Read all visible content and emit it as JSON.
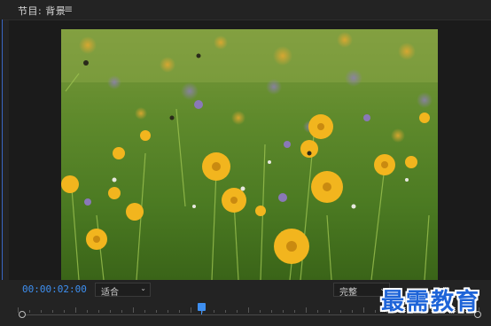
{
  "panel": {
    "title": "节目: 背景",
    "menu_icon": "≡"
  },
  "frame": {
    "subject": "meadow-flowers-photo"
  },
  "controls": {
    "timecode": "00:00:02:00",
    "fit_dropdown": "适合",
    "resolution_dropdown": "完整",
    "chevron": "⌄"
  },
  "playhead": {
    "position_fraction": 0.4
  },
  "watermark": {
    "text": "最需教育"
  },
  "colors": {
    "accent": "#3e8ff0",
    "background": "#232323",
    "viewer_bg": "#1b1b1b",
    "watermark": "#1e64d8"
  }
}
